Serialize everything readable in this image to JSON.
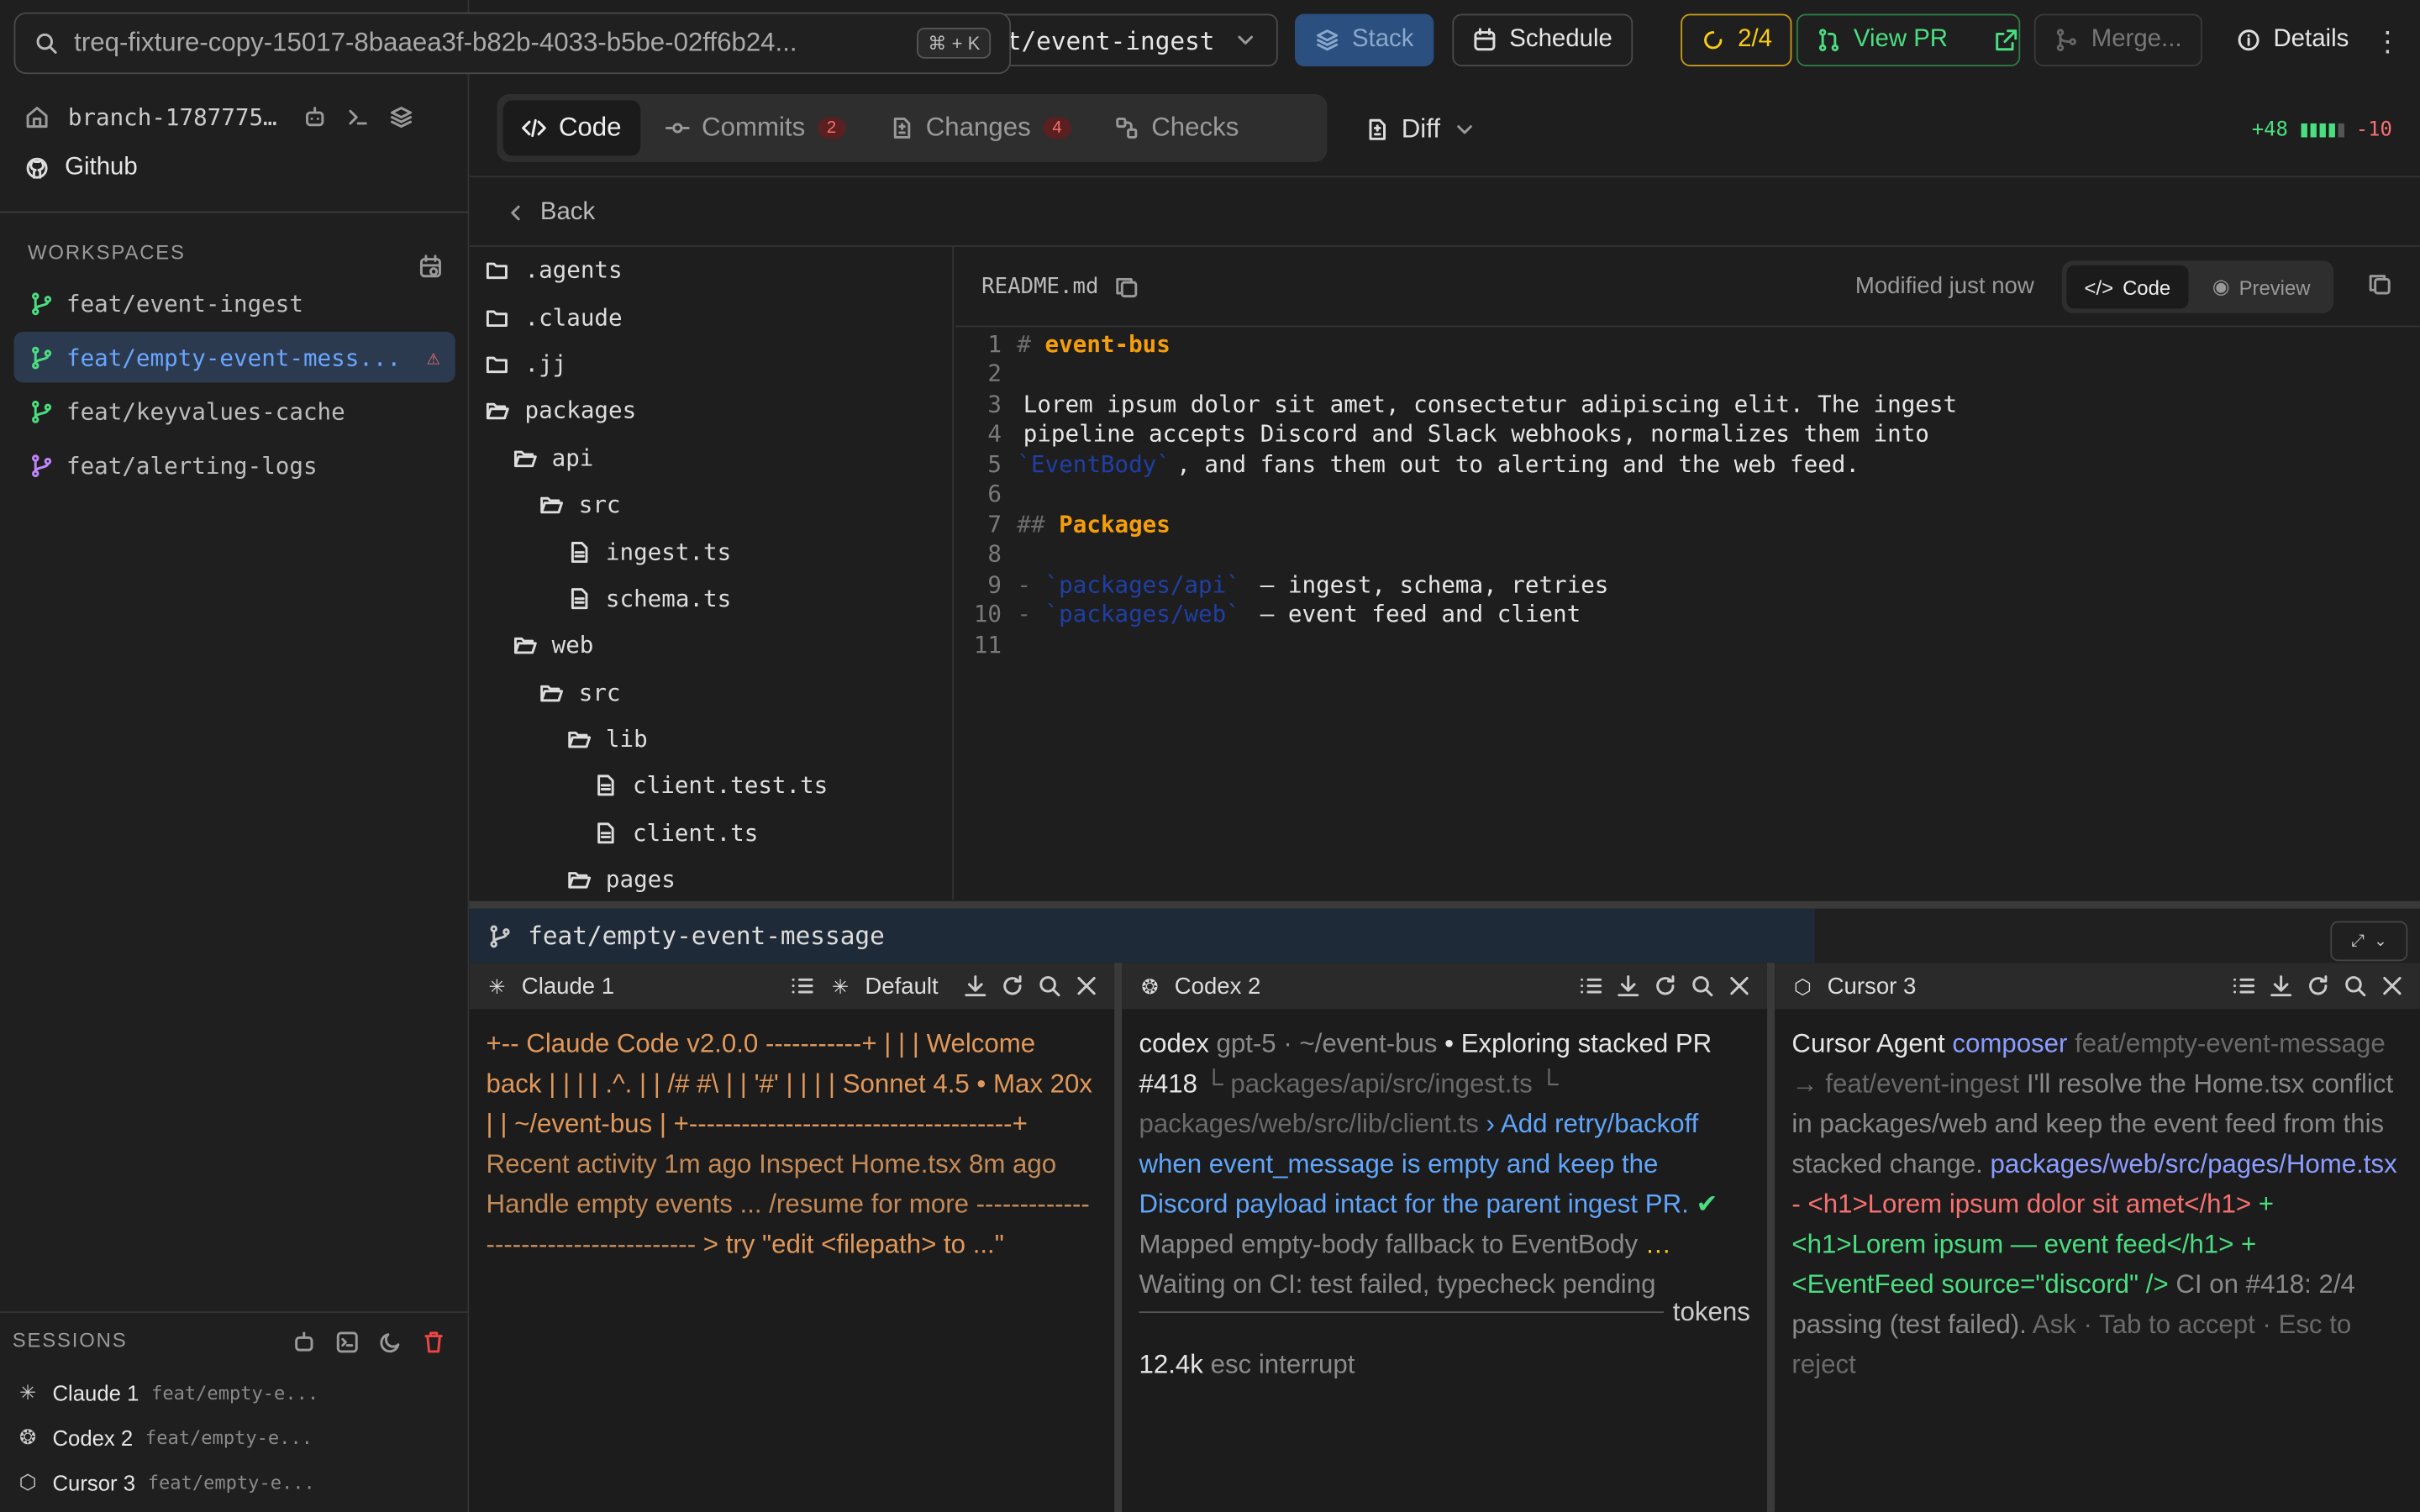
{
  "search": {
    "text": "treq-fixture-copy-15017-8baaea3f-b82b-4033-b5be-02ff6b24...",
    "overlay": "feat/empty-event-message",
    "shortcut": "⌘ + K"
  },
  "sidebar": {
    "branch_label": "branch-1787775...",
    "github_label": "Github",
    "workspaces_title": "WORKSPACES",
    "workspaces": [
      {
        "name": "feat/event-ingest",
        "active": false,
        "warning": false,
        "color": "#4ade80"
      },
      {
        "name": "feat/empty-event-mess...",
        "active": true,
        "warning": true,
        "color": "#4ade80"
      },
      {
        "name": "feat/keyvalues-cache",
        "active": false,
        "warning": false,
        "color": "#4ade80"
      },
      {
        "name": "feat/alerting-logs",
        "active": false,
        "warning": false,
        "color": "#c084fc"
      }
    ],
    "sessions_title": "SESSIONS",
    "sessions": [
      {
        "name": "Claude 1",
        "branch": "feat/empty-e...",
        "icon": "claude-icon"
      },
      {
        "name": "Codex 2",
        "branch": "feat/empty-e...",
        "icon": "openai-icon"
      },
      {
        "name": "Cursor 3",
        "branch": "feat/empty-e...",
        "icon": "cursor-icon"
      }
    ]
  },
  "topbar": {
    "branch_select": "feat/event-ingest",
    "stack_label": "Stack",
    "schedule_label": "Schedule",
    "checks_label": "2/4",
    "viewpr_label": "View PR",
    "merge_label": "Merge...",
    "details_label": "Details"
  },
  "tabs": [
    {
      "label": "Code",
      "active": true,
      "badge": ""
    },
    {
      "label": "Commits",
      "active": false,
      "badge": "2"
    },
    {
      "label": "Changes",
      "active": false,
      "badge": "4"
    },
    {
      "label": "Checks",
      "active": false,
      "badge": ""
    }
  ],
  "diff_mode": "Diff",
  "diffstat": {
    "plus": "+48",
    "minus": "-10"
  },
  "back_label": "Back",
  "tree": [
    {
      "name": ".agents",
      "type": "folder",
      "depth": 0
    },
    {
      "name": ".claude",
      "type": "folder",
      "depth": 0
    },
    {
      "name": ".jj",
      "type": "folder",
      "depth": 0
    },
    {
      "name": "packages",
      "type": "folder-open",
      "depth": 0
    },
    {
      "name": "api",
      "type": "folder-open",
      "depth": 1
    },
    {
      "name": "src",
      "type": "folder-open",
      "depth": 2
    },
    {
      "name": "ingest.ts",
      "type": "file",
      "depth": 3
    },
    {
      "name": "schema.ts",
      "type": "file",
      "depth": 3
    },
    {
      "name": "web",
      "type": "folder-open",
      "depth": 1
    },
    {
      "name": "src",
      "type": "folder-open",
      "depth": 2
    },
    {
      "name": "lib",
      "type": "folder-open",
      "depth": 3
    },
    {
      "name": "client.test.ts",
      "type": "file",
      "depth": 4
    },
    {
      "name": "client.ts",
      "type": "file",
      "depth": 4
    },
    {
      "name": "pages",
      "type": "folder-open",
      "depth": 3
    }
  ],
  "editor": {
    "filename": "README.md",
    "modified": "Modified just now",
    "view_code": "Code",
    "view_preview": "Preview",
    "lines": [
      {
        "n": "1",
        "parts": [
          [
            "hm",
            "# "
          ],
          [
            "h",
            "event-bus"
          ]
        ]
      },
      {
        "n": "2",
        "parts": []
      },
      {
        "n": "3",
        "parts": [
          [
            "c",
            "Lorem ipsum dolor sit amet, consectetur adipiscing elit. The ingest"
          ]
        ]
      },
      {
        "n": "4",
        "parts": [
          [
            "c",
            "pipeline accepts Discord and Slack webhooks, normalizes them into"
          ]
        ]
      },
      {
        "n": "5",
        "parts": [
          [
            "mk",
            "`EventBody`"
          ],
          [
            "c",
            ", and fans them out to alerting and the web feed."
          ]
        ]
      },
      {
        "n": "6",
        "parts": []
      },
      {
        "n": "7",
        "parts": [
          [
            "hm",
            "## "
          ],
          [
            "h",
            "Packages"
          ]
        ]
      },
      {
        "n": "8",
        "parts": []
      },
      {
        "n": "9",
        "parts": [
          [
            "hm",
            "- "
          ],
          [
            "mk",
            "`packages/api`"
          ],
          [
            "c",
            " — ingest, schema, retries"
          ]
        ]
      },
      {
        "n": "10",
        "parts": [
          [
            "hm",
            "- "
          ],
          [
            "mk",
            "`packages/web`"
          ],
          [
            "c",
            " — event feed and client"
          ]
        ]
      },
      {
        "n": "11",
        "parts": []
      }
    ]
  },
  "terminal": {
    "workspace": "feat/empty-event-message",
    "panes": [
      {
        "title": "Claude 1",
        "mode": "Default",
        "body": [
          [
            "orange",
            "+-- Claude Code v2.0.0 -----------+ | | | Welcome back | | | | .^. | | /# #\\ | | '#' | | | | Sonnet 4.5 • Max 20x | | ~/event-bus | +-------------------------------------+ "
          ],
          [
            "gray-orange",
            "Recent activity 1m ago Inspect Home.tsx 8m ago Handle empty events ... /resume for more ------------------------------------- "
          ],
          [
            "orange",
            "> try \"edit <filepath> to ...\""
          ]
        ]
      },
      {
        "title": "Codex 2",
        "body": [
          [
            "wht",
            "codex "
          ],
          [
            "gray",
            "gpt-5 · ~/event-bus "
          ],
          [
            "wht",
            "• Exploring stacked PR #418 "
          ],
          [
            "dimg",
            "└ packages/api/src/ingest.ts └ packages/web/src/lib/client.ts "
          ],
          [
            "blue",
            "› Add retry/backoff when event_message is empty and keep the Discord payload intact for the parent ingest PR. "
          ],
          [
            "grn",
            "✔ "
          ],
          [
            "gray",
            "Mapped empty-body fallback to EventBody "
          ],
          [
            "ylw",
            "… "
          ],
          [
            "gray",
            "Waiting on CI: test failed, typecheck pending"
          ]
        ],
        "footer_tokens": "tokens",
        "footer_count": "12.4k",
        "footer_hint": "esc interrupt"
      },
      {
        "title": "Cursor 3",
        "body": [
          [
            "wht",
            "Cursor Agent "
          ],
          [
            "purple",
            "composer "
          ],
          [
            "dimg",
            "feat/empty-event-message → feat/event-ingest "
          ],
          [
            "gray",
            "I'll resolve the Home.tsx conflict in packages/web and keep the event feed from this stacked change. "
          ],
          [
            "purple",
            "packages/web/src/pages/Home.tsx "
          ],
          [
            "red",
            "- <h1>Lorem ipsum dolor sit amet</h1> "
          ],
          [
            "grn",
            "+ <h1>Lorem ipsum — event feed</h1> + <EventFeed source=\"discord\" /> "
          ],
          [
            "gray",
            "CI on #418: 2/4 passing (test failed). "
          ],
          [
            "dimg",
            "Ask · Tab to accept · Esc to reject"
          ]
        ]
      }
    ]
  }
}
